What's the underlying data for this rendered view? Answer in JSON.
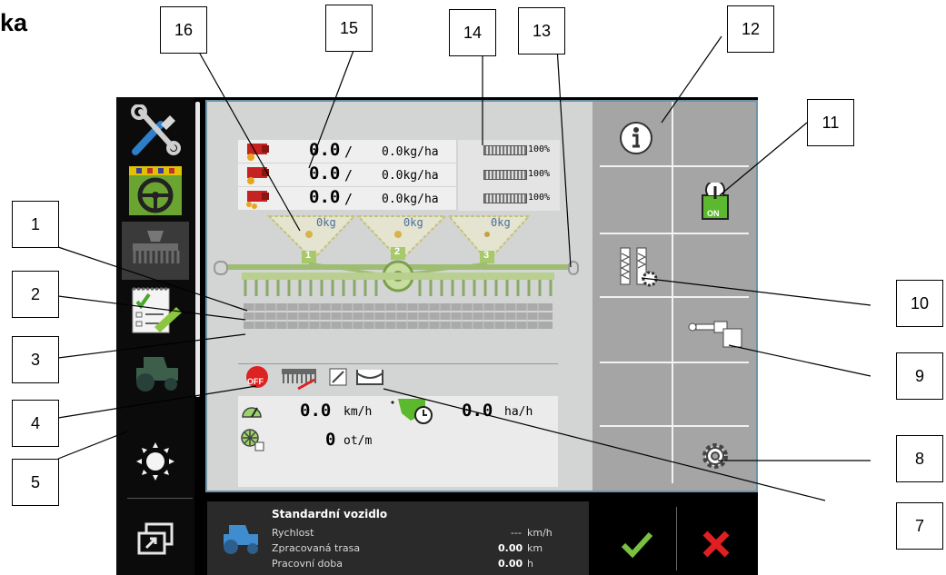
{
  "heading": "ka",
  "callouts": [
    "1",
    "2",
    "3",
    "4",
    "5",
    "7",
    "8",
    "9",
    "10",
    "11",
    "12",
    "13",
    "14",
    "15",
    "16"
  ],
  "sidebar": {
    "items": [
      {
        "name": "tools-icon"
      },
      {
        "name": "steering-icon"
      },
      {
        "name": "seeder-icon"
      },
      {
        "name": "tasks-icon"
      },
      {
        "name": "tractor-icon"
      },
      {
        "name": "brightness-icon"
      },
      {
        "name": "switch-window-icon"
      }
    ]
  },
  "tanks": [
    {
      "value": "0.0",
      "slash": "/",
      "rate": "0.0kg/ha",
      "percent": "100%",
      "kg": "0kg",
      "num": "1"
    },
    {
      "value": "0.0",
      "slash": "/",
      "rate": "0.0kg/ha",
      "percent": "100%",
      "kg": "0kg",
      "num": "2"
    },
    {
      "value": "0.0",
      "slash": "/",
      "rate": "0.0kg/ha",
      "percent": "100%",
      "kg": "0kg",
      "num": "3"
    }
  ],
  "status_icons": {
    "off_label": "OFF",
    "on_label": "ON"
  },
  "readouts": {
    "speed_value": "0.0",
    "speed_unit": "km/h",
    "area_value": "0.0",
    "area_unit": "ha/h",
    "rpm_value": "0",
    "rpm_unit": "ot/m"
  },
  "vehicle": {
    "name": "Standardní vozidlo",
    "rows": [
      {
        "label": "Rychlost",
        "value": "---",
        "unit": "km/h"
      },
      {
        "label": "Zpracovaná trasa",
        "value": "0.00",
        "unit": "km"
      },
      {
        "label": "Pracovní doba",
        "value": "0.00",
        "unit": "h"
      }
    ]
  },
  "colors": {
    "accent_green": "#7ac143",
    "cancel_red": "#e02020",
    "frame_blue": "#6d93a8"
  }
}
